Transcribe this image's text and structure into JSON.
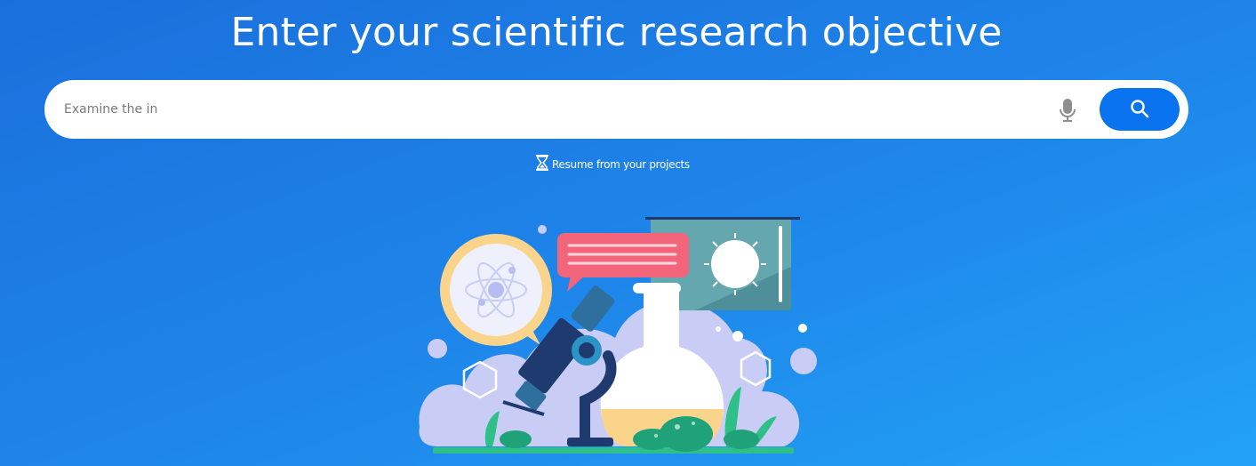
{
  "page": {
    "title": "Enter your scientific research objective"
  },
  "search": {
    "value": "Examine the in",
    "placeholder": "",
    "mic_icon": "microphone-icon",
    "button_icon": "search-icon"
  },
  "resume": {
    "label": "Resume from your projects",
    "icon": "hourglass-icon"
  },
  "colors": {
    "background_start": "#1a6fdc",
    "background_end": "#22a2f6",
    "search_button": "#0a74f0",
    "bubble_red": "#f2657a",
    "board_teal": "#4e8f99",
    "cloud": "#c9cdf6",
    "plant_green": "#2fc08a"
  }
}
